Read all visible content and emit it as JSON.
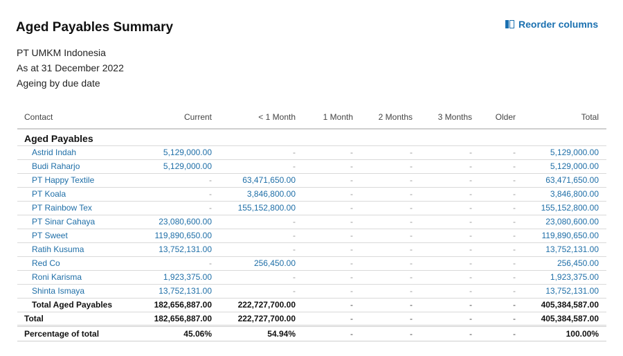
{
  "report": {
    "title": "Aged Payables Summary",
    "organization": "PT UMKM Indonesia",
    "as_at": "As at 31 December 2022",
    "ageing": "Ageing by due date"
  },
  "toolbar": {
    "reorder_label": "Reorder columns",
    "reorder_icon": "columns-icon",
    "accent_color": "#1a70b0"
  },
  "table": {
    "columns": [
      "Contact",
      "Current",
      "< 1 Month",
      "1 Month",
      "2 Months",
      "3 Months",
      "Older",
      "Total"
    ],
    "section_title": "Aged Payables",
    "rows": [
      {
        "contact": "Astrid Indah",
        "values": [
          "5,129,000.00",
          "-",
          "-",
          "-",
          "-",
          "-",
          "5,129,000.00"
        ]
      },
      {
        "contact": "Budi Raharjo",
        "values": [
          "5,129,000.00",
          "-",
          "-",
          "-",
          "-",
          "-",
          "5,129,000.00"
        ]
      },
      {
        "contact": "PT Happy Textile",
        "values": [
          "-",
          "63,471,650.00",
          "-",
          "-",
          "-",
          "-",
          "63,471,650.00"
        ]
      },
      {
        "contact": "PT Koala",
        "values": [
          "-",
          "3,846,800.00",
          "-",
          "-",
          "-",
          "-",
          "3,846,800.00"
        ]
      },
      {
        "contact": "PT Rainbow Tex",
        "values": [
          "-",
          "155,152,800.00",
          "-",
          "-",
          "-",
          "-",
          "155,152,800.00"
        ]
      },
      {
        "contact": "PT Sinar Cahaya",
        "values": [
          "23,080,600.00",
          "-",
          "-",
          "-",
          "-",
          "-",
          "23,080,600.00"
        ]
      },
      {
        "contact": "PT Sweet",
        "values": [
          "119,890,650.00",
          "-",
          "-",
          "-",
          "-",
          "-",
          "119,890,650.00"
        ]
      },
      {
        "contact": "Ratih Kusuma",
        "values": [
          "13,752,131.00",
          "-",
          "-",
          "-",
          "-",
          "-",
          "13,752,131.00"
        ]
      },
      {
        "contact": "Red Co",
        "values": [
          "-",
          "256,450.00",
          "-",
          "-",
          "-",
          "-",
          "256,450.00"
        ]
      },
      {
        "contact": "Roni Karisma",
        "values": [
          "1,923,375.00",
          "-",
          "-",
          "-",
          "-",
          "-",
          "1,923,375.00"
        ]
      },
      {
        "contact": "Shinta Ismaya",
        "values": [
          "13,752,131.00",
          "-",
          "-",
          "-",
          "-",
          "-",
          "13,752,131.00"
        ]
      }
    ],
    "subtotal": {
      "label": "Total Aged Payables",
      "values": [
        "182,656,887.00",
        "222,727,700.00",
        "-",
        "-",
        "-",
        "-",
        "405,384,587.00"
      ]
    },
    "total": {
      "label": "Total",
      "values": [
        "182,656,887.00",
        "222,727,700.00",
        "-",
        "-",
        "-",
        "-",
        "405,384,587.00"
      ]
    },
    "percentage": {
      "label": "Percentage of total",
      "values": [
        "45.06%",
        "54.94%",
        "-",
        "-",
        "-",
        "-",
        "100.00%"
      ]
    }
  }
}
